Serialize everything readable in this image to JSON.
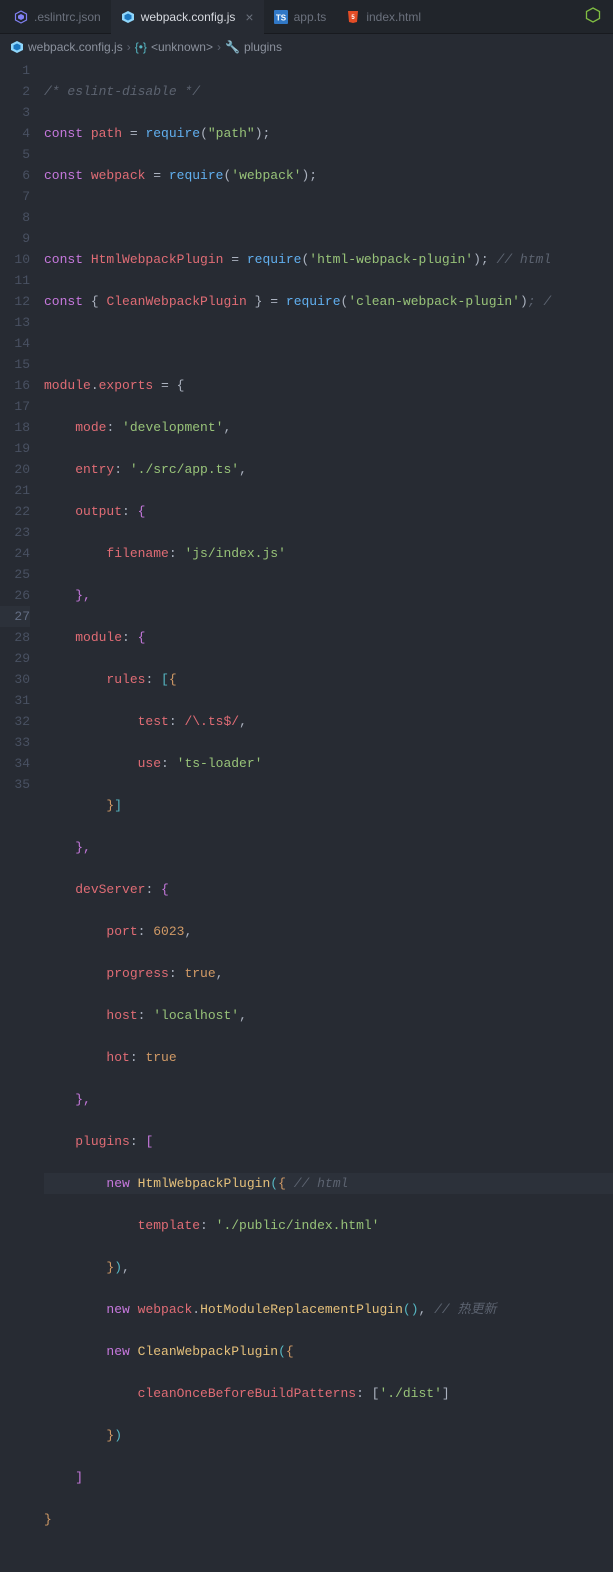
{
  "tabs": [
    {
      "label": ".eslintrc.json",
      "icon": "eslint",
      "active": false
    },
    {
      "label": "webpack.config.js",
      "icon": "webpack",
      "active": true
    },
    {
      "label": "app.ts",
      "icon": "ts",
      "active": false
    },
    {
      "label": "index.html",
      "icon": "html",
      "active": false
    }
  ],
  "nodeIcon": "nodejs",
  "breadcrumb": {
    "file": "webpack.config.js",
    "unknown": "<unknown>",
    "section": "plugins"
  },
  "code": {
    "lines": 35,
    "highlighted_line": 27,
    "l1_comment": "/* eslint-disable */",
    "l2": {
      "kw": "const",
      "v": "path",
      "op": " = ",
      "fn": "require",
      "arg": "\"path\""
    },
    "l3": {
      "kw": "const",
      "v": "webpack",
      "op": " = ",
      "fn": "require",
      "arg": "'webpack'"
    },
    "l5": {
      "kw": "const",
      "v": "HtmlWebpackPlugin",
      "op": " = ",
      "fn": "require",
      "arg": "'html-webpack-plugin'",
      "cm": " // html"
    },
    "l6": {
      "kw": "const",
      "d1": "{ ",
      "v": "CleanWebpackPlugin",
      "d2": " }",
      "op": " = ",
      "fn": "require",
      "arg": "'clean-webpack-plugin'",
      "tail": "; /"
    },
    "l8": {
      "o": "module",
      "p": "exports",
      "eq": " = {"
    },
    "l9": {
      "k": "mode",
      "v": "'development'"
    },
    "l10": {
      "k": "entry",
      "v": "'./src/app.ts'"
    },
    "l11": {
      "k": "output",
      "v": "{"
    },
    "l12": {
      "k": "filename",
      "v": "'js/index.js'"
    },
    "l13": "},",
    "l14": {
      "k": "module",
      "v": "{"
    },
    "l15": {
      "k": "rules",
      "v": "[{"
    },
    "l16": {
      "k": "test",
      "v": "/\\.ts$/"
    },
    "l17": {
      "k": "use",
      "v": "'ts-loader'"
    },
    "l18": "}]",
    "l19": "},",
    "l20": {
      "k": "devServer",
      "v": "{"
    },
    "l21": {
      "k": "port",
      "v": "6023"
    },
    "l22": {
      "k": "progress",
      "v": "true"
    },
    "l23": {
      "k": "host",
      "v": "'localhost'"
    },
    "l24": {
      "k": "hot",
      "v": "true"
    },
    "l25": "},",
    "l26": {
      "k": "plugins",
      "v": "["
    },
    "l27": {
      "kw": "new",
      "cls": "HtmlWebpackPlugin",
      "cm": " // html"
    },
    "l28": {
      "k": "template",
      "v": "'./public/index.html'"
    },
    "l29": "}),",
    "l30": {
      "kw": "new",
      "obj": "webpack",
      "cls": "HotModuleReplacementPlugin",
      "cm": " // 热更新"
    },
    "l31": {
      "kw": "new",
      "cls": "CleanWebpackPlugin"
    },
    "l32": {
      "k": "cleanOnceBeforeBuildPatterns",
      "v": "'./dist'"
    },
    "l33": "})",
    "l34": "]",
    "l35": "}"
  }
}
